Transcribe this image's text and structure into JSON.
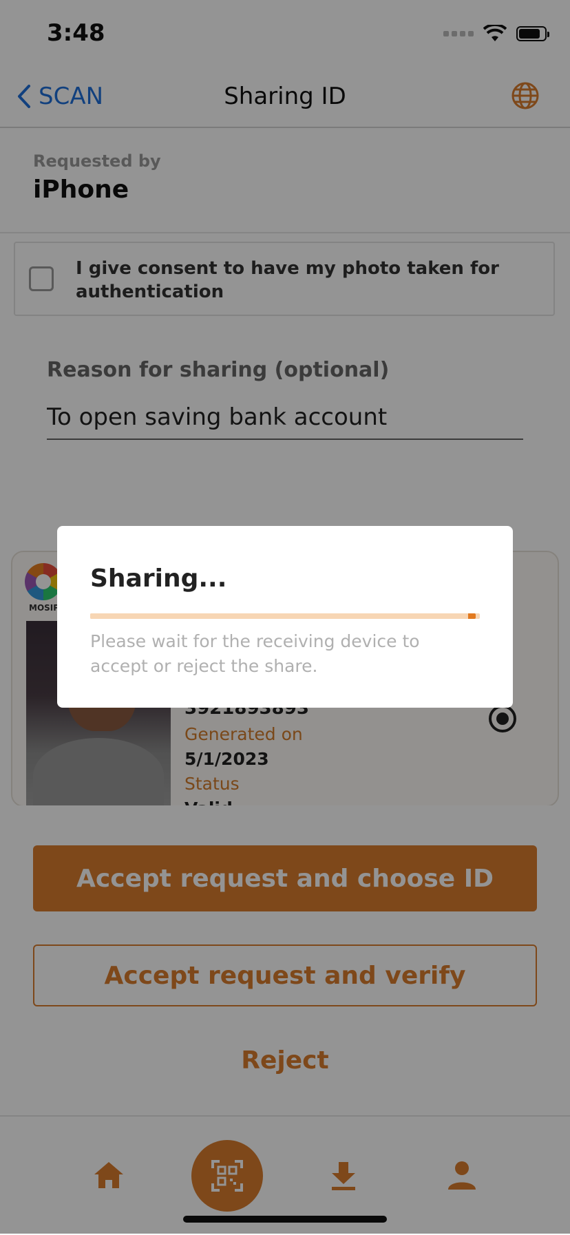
{
  "status_bar": {
    "time": "3:48",
    "icons": [
      "signal-icon",
      "wifi-icon",
      "battery-icon"
    ]
  },
  "nav": {
    "back_label": "SCAN",
    "title": "Sharing ID",
    "language_icon": "globe-icon"
  },
  "requested_by": {
    "label": "Requested by",
    "value": "iPhone"
  },
  "consent": {
    "checked": false,
    "text": "I give consent to have my photo taken for authentication"
  },
  "reason": {
    "label": "Reason for sharing (optional)",
    "value": "To open saving bank account"
  },
  "id_card": {
    "logo_text": "MOSIP",
    "id_number": "3921893893",
    "generated_label": "Generated on",
    "generated_value": "5/1/2023",
    "status_label": "Status",
    "status_value": "Valid"
  },
  "actions": {
    "accept_choose": "Accept request and choose ID",
    "accept_verify": "Accept request and verify",
    "reject": "Reject"
  },
  "tabbar": {
    "items": [
      "home-icon",
      "qr-scan-icon",
      "download-icon",
      "profile-icon"
    ]
  },
  "dialog": {
    "title": "Sharing...",
    "message": "Please wait for the receiving device to accept or reject the share.",
    "progress": 0.99
  },
  "colors": {
    "accent": "#d97d2e",
    "link": "#1e6fd9",
    "overlay": "rgba(0,0,0,0.42)"
  }
}
